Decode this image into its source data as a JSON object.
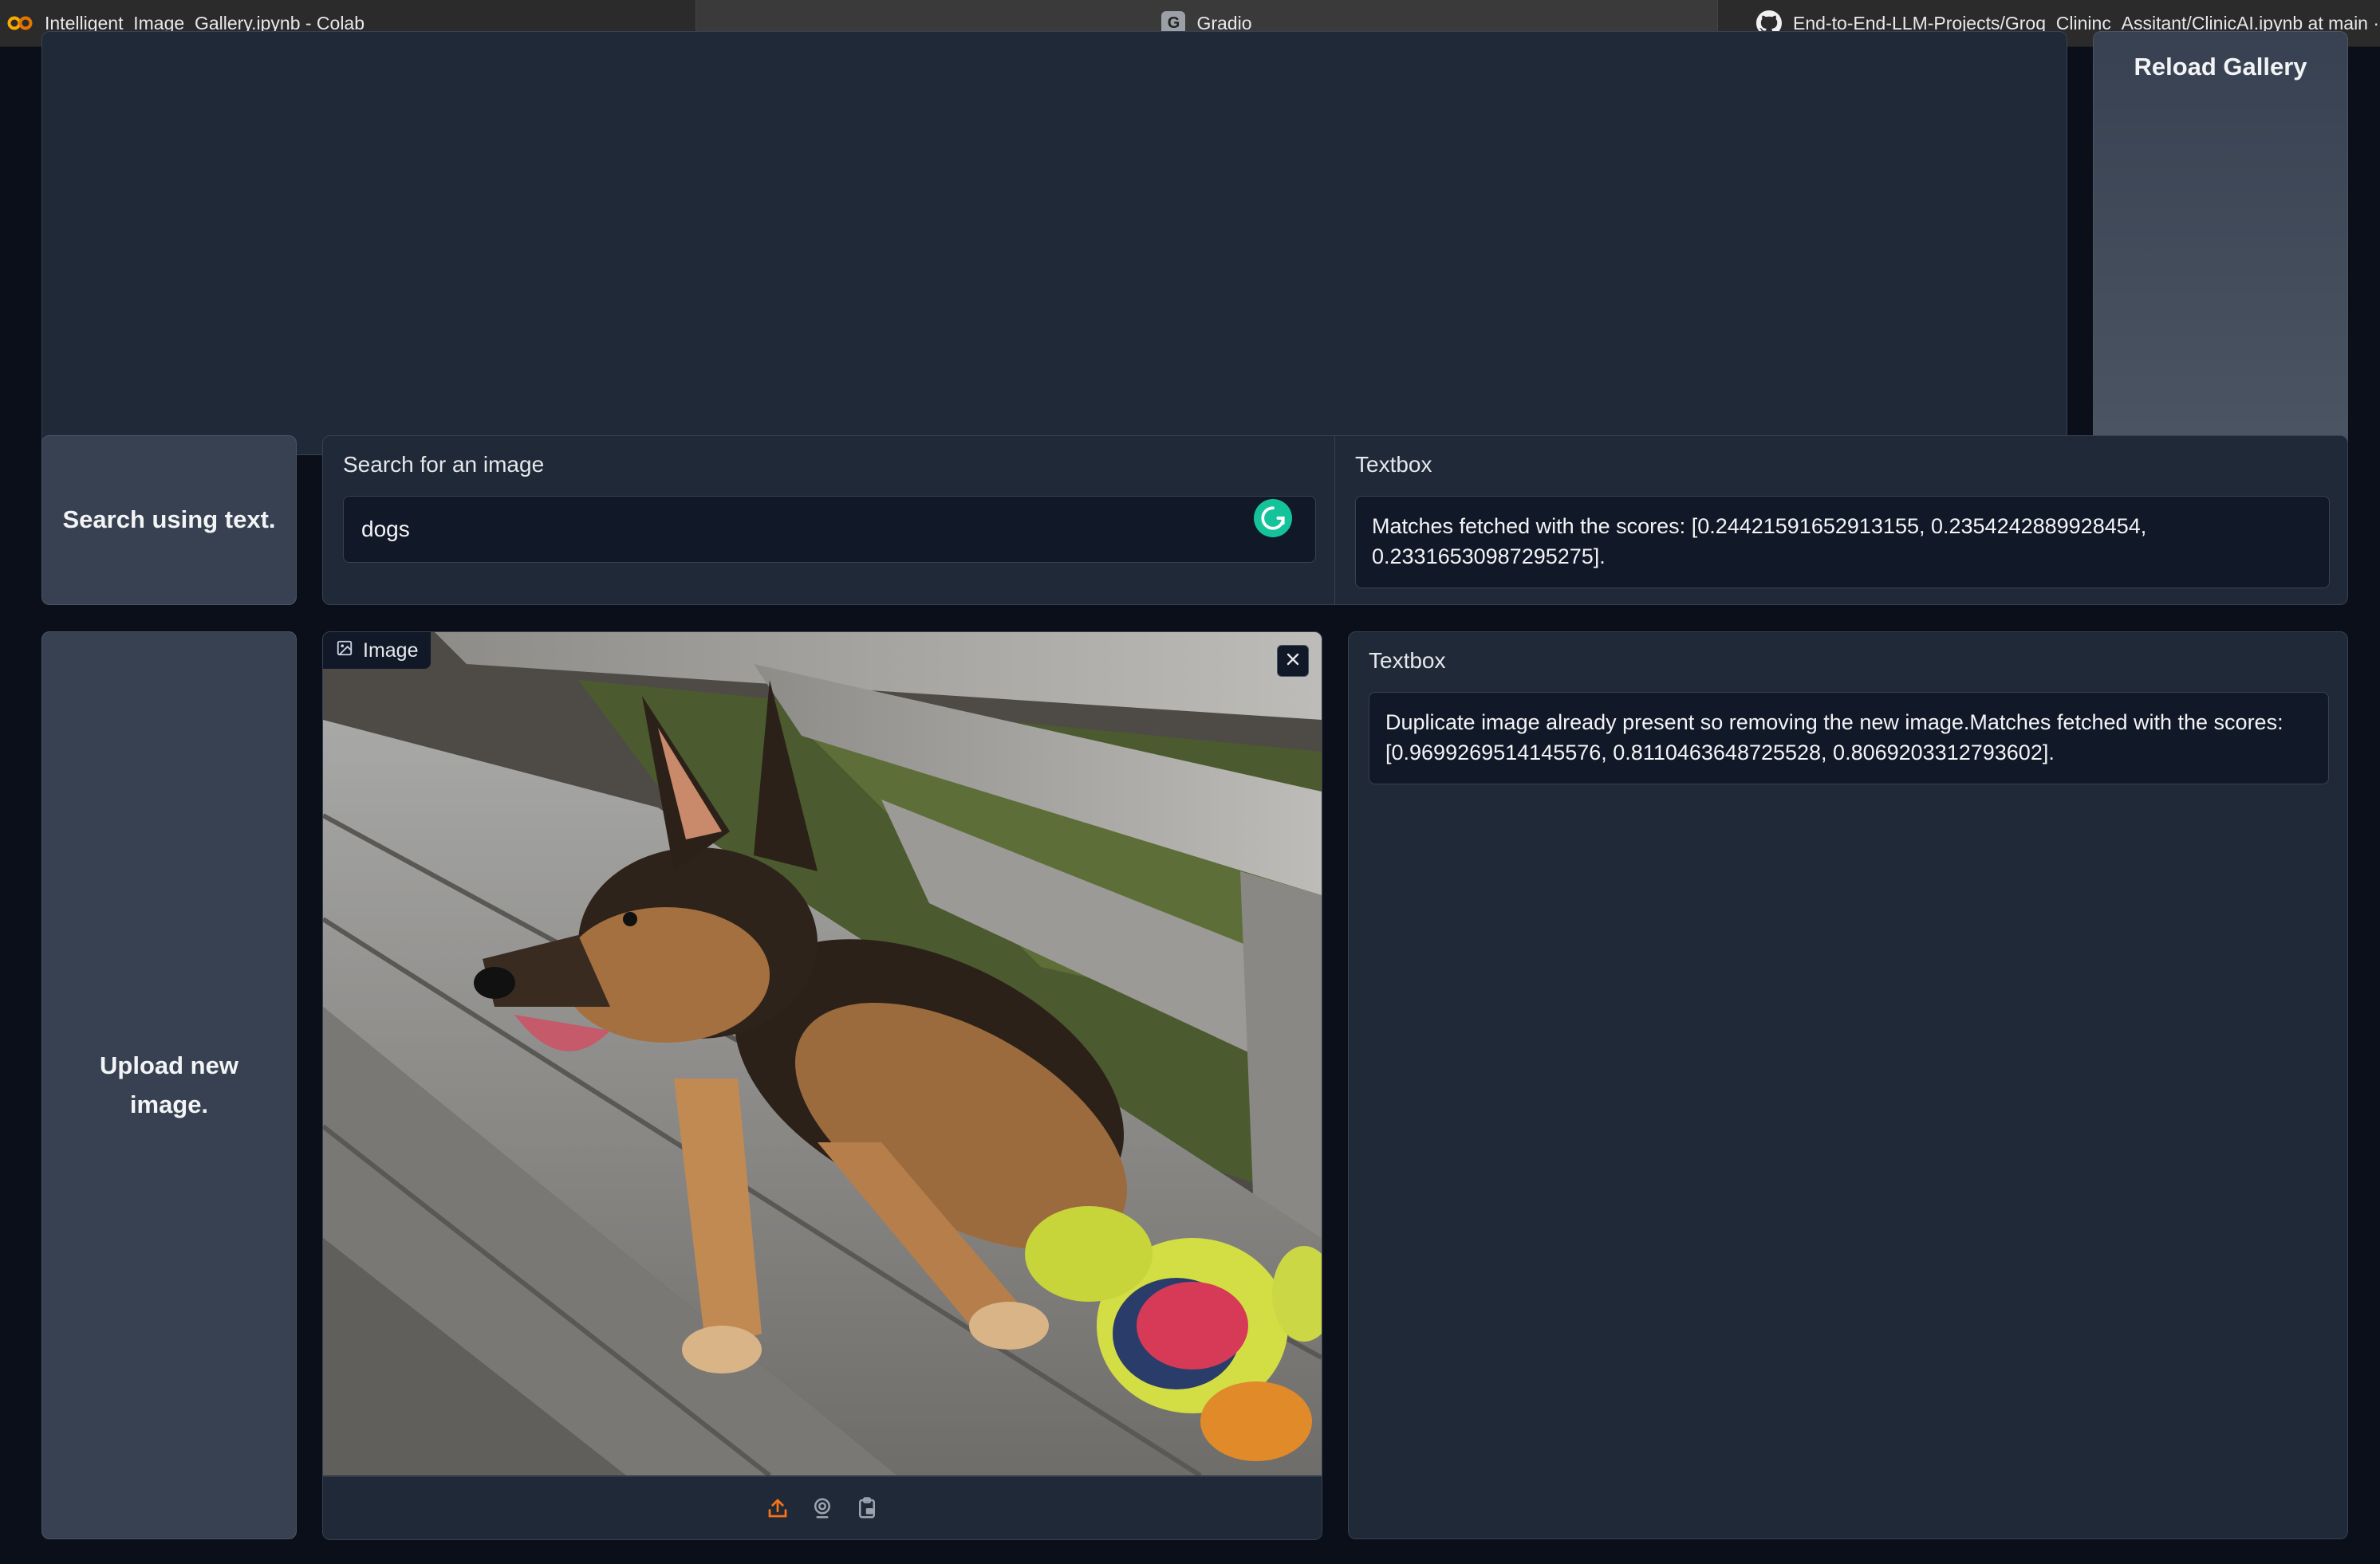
{
  "browser": {
    "tabs": [
      {
        "title": "Intelligent_Image_Gallery.ipynb - Colab",
        "icon": "colab-icon"
      },
      {
        "title": "Gradio",
        "icon": "gradio-icon",
        "favicon_letter": "G"
      },
      {
        "title": "End-to-End-LLM-Projects/Groq_Clininc_Assitant/ClinicAI.ipynb at main ·",
        "icon": "github-icon"
      }
    ]
  },
  "gallery": {
    "reload_label": "Reload Gallery"
  },
  "search": {
    "button_label": "Search using text.",
    "field_label": "Search for an image",
    "query": "dogs",
    "result_label": "Textbox",
    "result_text": "Matches fetched with the scores: [0.24421591652913155, 0.2354242889928454, 0.23316530987295275]."
  },
  "upload": {
    "button_label": "Upload new image.",
    "image_label": "Image",
    "image_description": "German Shepherd dog lying on a wooden bench next to a yellow plush toy",
    "result_label": "Textbox",
    "result_text": "Duplicate image already present so removing the new image.Matches fetched with the scores: [0.9699269514145576, 0.8110463648725528, 0.8069203312793602]."
  },
  "colors": {
    "background": "#0b0f19",
    "block": "#1f2937",
    "border": "#374151",
    "accent": "#f97316"
  }
}
